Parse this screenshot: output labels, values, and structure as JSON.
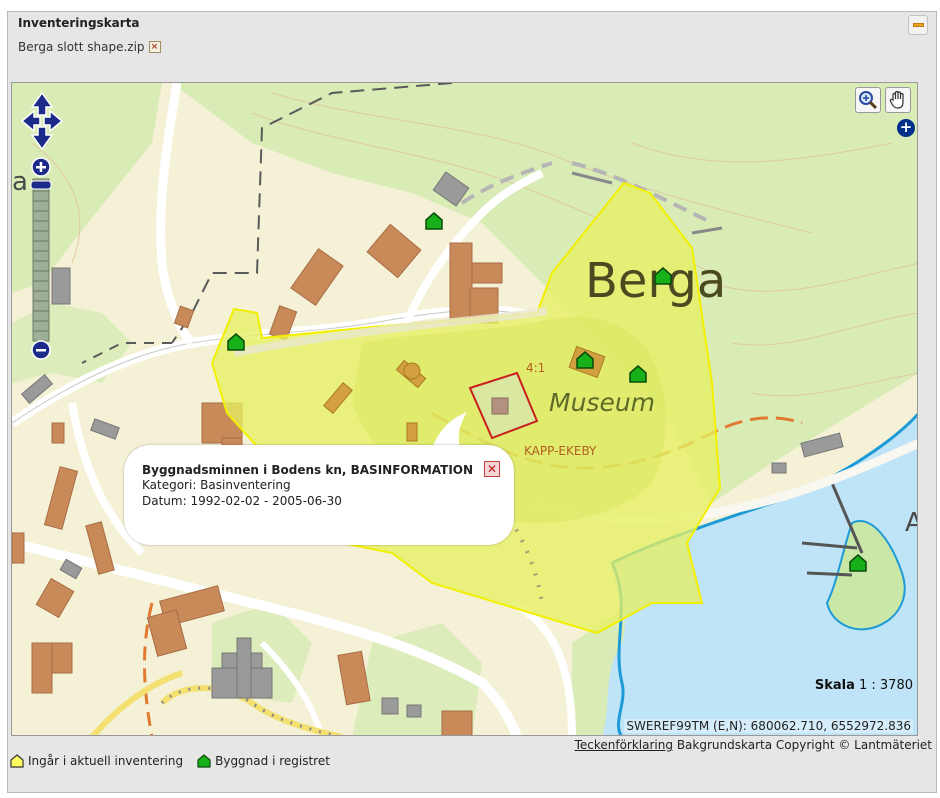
{
  "panel": {
    "title": "Inventeringskarta",
    "file_name": "Berga slott shape.zip"
  },
  "map": {
    "place_label": "Berga",
    "museum_label": "Museum",
    "road_label": "KAPP-EKEBY",
    "parcel_label": "4:1",
    "edge_label_left": "a",
    "edge_label_right": "A",
    "scale_label": "Skala",
    "scale_value": "1 : 3780",
    "coords_label": "SWEREF99TM (E,N):",
    "coords_value": "680062.710, 6552972.836"
  },
  "popup": {
    "title": "Byggnadsminnen i Bodens kn, BASINFORMATION",
    "category": "Kategori: Basinventering",
    "date": "Datum: 1992-02-02 - 2005-06-30",
    "close_symbol": "✕"
  },
  "attribution": {
    "legend_link": "Teckenförklaring",
    "copyright": "Bakgrundskarta Copyright © Lantmäteriet"
  },
  "legend": {
    "inventory": "Ingår i aktuell inventering",
    "registered": "Byggnad i registret"
  },
  "colors": {
    "inventory_fill": "#e2ef60",
    "inventory_stroke": "#f2f000",
    "building_marker": "#18b018",
    "water": "#bfe3f7",
    "forest": "#d8ecb4",
    "building": "#c98a5a",
    "nav_blue": "#1c2a8a"
  },
  "icons": {
    "collapse": "minimize-icon",
    "file_remove": "remove-file-icon",
    "pan": "pan-arrows-icon",
    "zoom_in": "zoom-in-icon",
    "zoom_out": "zoom-out-icon",
    "zoom_box": "zoom-box-icon",
    "hand": "hand-pan-icon",
    "layers": "layer-switcher-icon"
  }
}
